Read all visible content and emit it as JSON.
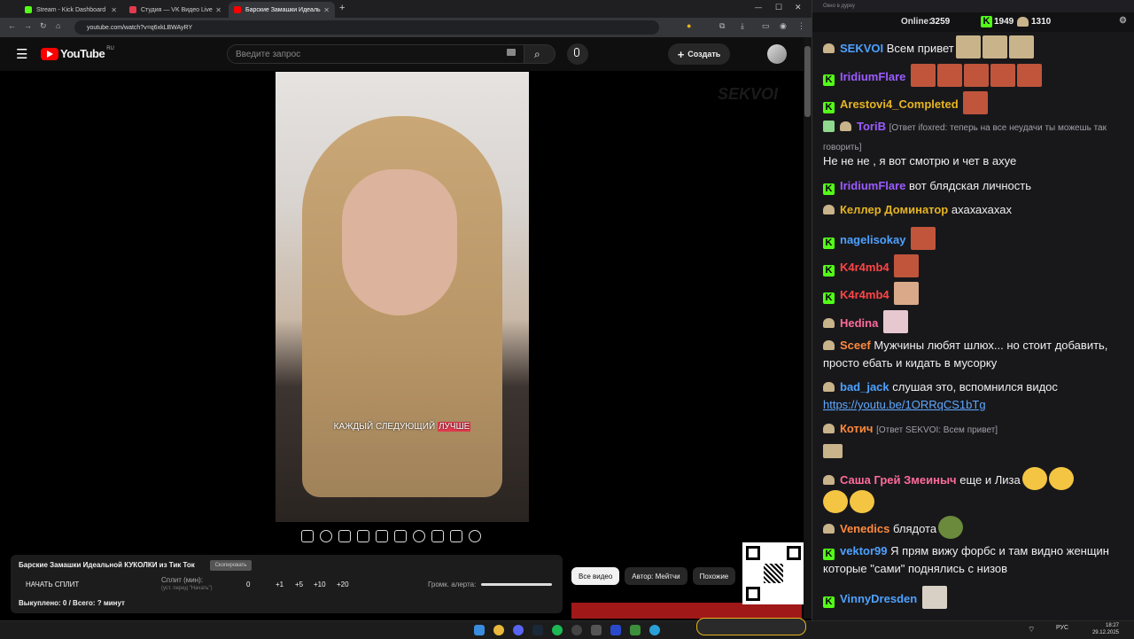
{
  "browser": {
    "tabs": [
      {
        "label": "Stream - Kick Dashboard",
        "color": "#53fc18"
      },
      {
        "label": "Студия — VK Видео Live",
        "color": "#e23a4d"
      },
      {
        "label": "Барские Замашки Идеаль",
        "color": "#ff0000"
      }
    ],
    "url": "youtube.com/watch?v=q6xkLBWAyRY"
  },
  "youtube": {
    "logo_text": "YouTube",
    "region": "RU",
    "search_placeholder": "Введите запрос",
    "create_label": "Создать",
    "subtitle_pre": "КАЖДЫЙ СЛЕДУЮЩИЙ ",
    "subtitle_hl": "ЛУЧШЕ",
    "watermark": "SEKVOI"
  },
  "panel": {
    "title": "Барские Замашки Идеальной КУКОЛКИ из Тик Ток",
    "copy_label": "Скопировать",
    "start_split": "НАЧАТЬ СПЛИТ",
    "split_label": "Сплит (мин):",
    "split_hint": "(уст. перед \"Начать\")",
    "split_value": "0",
    "increments": [
      "+1",
      "+5",
      "+10",
      "+20"
    ],
    "volume_label": "Громк. алерта:",
    "bought": "Выкуплено: 0 / Всего: ? минут"
  },
  "filters": [
    "Все видео",
    "Автор: Мейтчи",
    "Похожие"
  ],
  "chat": {
    "window_title": "Окно в дурку",
    "online_label": "Online:",
    "online_count": "3259",
    "kick_count": "1949",
    "emote_count": "1310",
    "messages": [
      {
        "user": "SEKVOI",
        "text": "Всем привет",
        "color": "#4ea1ff",
        "badge": "emote"
      },
      {
        "user": "IridiumFlare",
        "text": "",
        "color": "#9b5cff",
        "badge": "kick"
      },
      {
        "user": "Arestovi4_Completed",
        "text": "",
        "color": "#e6b422",
        "badge": "kick"
      },
      {
        "user": "ToriB",
        "reply": "[Ответ ifoxred: теперь на все неудачи ты можешь так говорить]",
        "text": "Не не не , я вот смотрю и чет в ахуе",
        "color": "#9b5cff",
        "badge": "emote"
      },
      {
        "user": "IridiumFlare",
        "text": "вот блядская личность",
        "color": "#9b5cff",
        "badge": "kick"
      },
      {
        "user": "Келлер Доминатор",
        "text": "ахахахахах",
        "color": "#e6b422",
        "badge": "emote"
      },
      {
        "user": "nagelisokay",
        "text": "",
        "color": "#4ea1ff",
        "badge": "kick"
      },
      {
        "user": "K4r4mb4",
        "text": "",
        "color": "#ff4545",
        "badge": "kick"
      },
      {
        "user": "K4r4mb4",
        "text": "",
        "color": "#ff4545",
        "badge": "kick"
      },
      {
        "user": "Hedina",
        "text": "",
        "color": "#ff6b9a",
        "badge": "emote"
      },
      {
        "user": "Sceef",
        "text": "Мужчины любят шлюх... но стоит добавить, просто ебать и кидать в мусорку",
        "color": "#ff8a3d",
        "badge": "emote"
      },
      {
        "user": "bad_jack",
        "text": "слушая это, вспомнился видос",
        "link": "https://youtu.be/1ORRqCS1bTg",
        "color": "#4ea1ff",
        "badge": "emote"
      },
      {
        "user": "Котич",
        "reply": "[Ответ SEKVOI: Всем привет]",
        "text": "",
        "color": "#ff8a3d",
        "badge": "emote"
      },
      {
        "user": "Саша Грей Змеиныч",
        "text": "еще и Лиза",
        "color": "#ff6b9a",
        "badge": "emote"
      },
      {
        "user": "Venedics",
        "text": "блядота",
        "color": "#ff8a3d",
        "badge": "emote"
      },
      {
        "user": "vektor99",
        "text": "Я прям вижу форбс и там видно женщин которые \"сами\" поднялись с низов",
        "color": "#4ea1ff",
        "badge": "kick"
      },
      {
        "user": "VinnyDresden",
        "text": "",
        "color": "#4ea1ff",
        "badge": "kick"
      }
    ]
  },
  "taskbar": {
    "lang": "РУС",
    "time": "18:27",
    "date": "29.12.2025"
  }
}
